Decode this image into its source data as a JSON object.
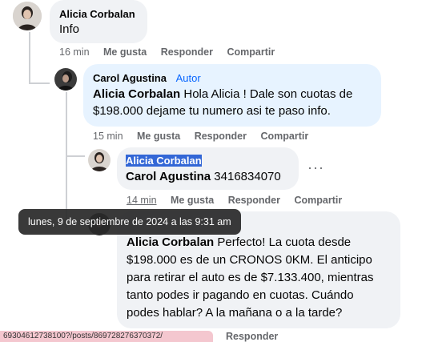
{
  "comments": [
    {
      "author": "Alicia Corbalan",
      "text": "Info",
      "time": "16 min",
      "actions": [
        "Me gusta",
        "Responder",
        "Compartir"
      ]
    },
    {
      "author": "Carol Agustina",
      "badge": "Autor",
      "mention": "Alicia Corbalan",
      "text_line1": " Hola Alicia ! Dale son cuotas de",
      "text_line2": "$198.000 dejame tu numero asi te paso info.",
      "time": "15 min",
      "actions": [
        "Me gusta",
        "Responder",
        "Compartir"
      ]
    },
    {
      "author": "Alicia Corbalan",
      "mention": "Carol Agustina",
      "text": " 3416834070",
      "time": "14 min",
      "actions": [
        "Me gusta",
        "Responder",
        "Compartir"
      ],
      "more": "···"
    },
    {
      "mention": "Alicia Corbalan",
      "lines": [
        " Perfecto! La cuota desde",
        "$198.000 es de un CRONOS 0KM. El anticipo",
        "para retirar el auto es de $7.133.400, mientras",
        "tanto podes ir pagando en cuotas. Cuándo",
        "podes hablar? A la mañana o a la tarde?"
      ],
      "actions": [
        "Responder"
      ]
    }
  ],
  "tooltip": "lunes, 9 de septiembre de 2024 a las 9:31 am",
  "status_url": "69304612738100?/posts/869728276370372/"
}
